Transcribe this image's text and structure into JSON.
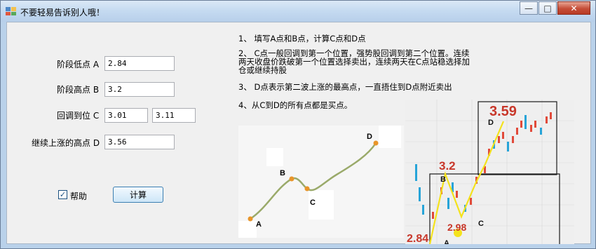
{
  "window": {
    "title": "不要轻易告诉别人哦！",
    "min_glyph": "—",
    "max_glyph": "□",
    "close_glyph": "✕"
  },
  "form": {
    "low_label": "阶段低点 A",
    "low_value": "2.84",
    "high_label": "阶段高点 B",
    "high_value": "3.2",
    "pullback_label": "回调到位 C",
    "pullback_value1": "3.01",
    "pullback_value2": "3.11",
    "continue_label": "继续上涨的高点 D",
    "continue_value": "3.56",
    "help_label": "帮助",
    "help_checked": true,
    "calc_label": "计算"
  },
  "instructions": {
    "line1": "1、 填写A点和B点，计算C点和D点",
    "line2a": "2、 C点一般回调到第一个位置，强势股回调到第二个位置。连续",
    "line2b": "两天收盘价跌破第一个位置选择卖出，连续两天在C点站稳选择加",
    "line2c": "仓或继续持股",
    "line3": "3、 D点表示第二波上涨的最高点，一直捂住到D点附近卖出",
    "line4": "4、从C到D的所有点都是买点。"
  },
  "diagram": {
    "a": "A",
    "b": "B",
    "c": "C",
    "d": "D",
    "line_color": "#9aaa6a",
    "point_color": "#e8952a"
  },
  "photo": {
    "val_359": "3.59",
    "val_32": "3.2",
    "val_298": "2.98",
    "val_284": "2.84",
    "a": "A",
    "b": "B",
    "c": "C",
    "d": "D",
    "accent": "#c8372a",
    "line_color": "#f4e21c"
  }
}
